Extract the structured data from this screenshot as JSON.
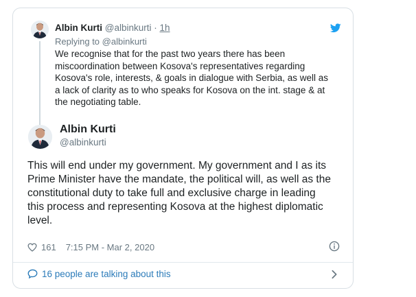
{
  "reply_tweet": {
    "author_name": "Albin Kurti",
    "author_handle": "@albinkurti",
    "separator": "·",
    "relative_time": "1h",
    "replying_to": "Replying to @albinkurti",
    "text": "We recognise that for the past two years there has been\nmiscoordination between Kosova's representatives regarding\nKosova's role, interests, & goals in dialogue with Serbia, as well as\na lack of clarity as to who speaks for Kosova on the int. stage & at\nthe negotiating table."
  },
  "main_tweet": {
    "author_name": "Albin Kurti",
    "author_handle": "@albinkurti",
    "text": "This will end under my government. My government and I as its\nPrime Minister have the mandate, the political will, as well as the\nconstitutional duty to take full and exclusive charge in leading\nthis process and representing Kosova at the highest diplomatic\nlevel.",
    "like_count": "161",
    "timestamp": "7:15 PM - Mar 2, 2020"
  },
  "conversation": {
    "label": "16 people are talking about this"
  },
  "icons": {
    "brand": "twitter-bird-icon",
    "like": "heart-icon",
    "info": "info-icon",
    "conversation": "speech-bubble-icon",
    "expand": "chevron-right-icon"
  },
  "colors": {
    "twitter_blue": "#1da1f2",
    "link_blue": "#2b7bb9",
    "muted_gray": "#697882",
    "text": "#1c2022",
    "border": "#d8dfe4"
  }
}
